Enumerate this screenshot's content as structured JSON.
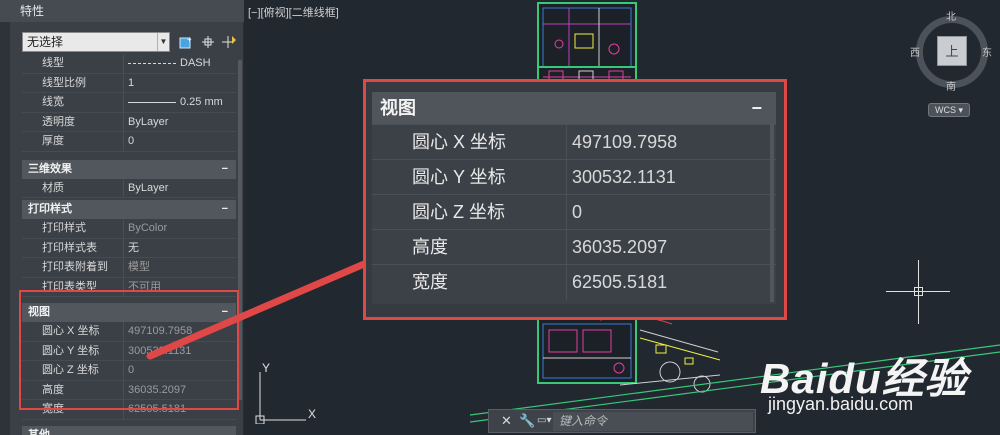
{
  "palette": {
    "title": "特性",
    "selection": "无选择",
    "general_rows": [
      {
        "label": "线型",
        "value": "DASH",
        "sample": "dash"
      },
      {
        "label": "线型比例",
        "value": "1"
      },
      {
        "label": "线宽",
        "value": "0.25 mm",
        "sample": "solid"
      },
      {
        "label": "透明度",
        "value": "ByLayer"
      },
      {
        "label": "厚度",
        "value": "0"
      }
    ],
    "sections": {
      "effects": {
        "title": "三维效果",
        "rows": [
          {
            "label": "材质",
            "value": "ByLayer"
          }
        ]
      },
      "plot": {
        "title": "打印样式",
        "rows": [
          {
            "label": "打印样式",
            "value": "ByColor"
          },
          {
            "label": "打印样式表",
            "value": "无"
          },
          {
            "label": "打印表附着到",
            "value": "模型"
          },
          {
            "label": "打印表类型",
            "value": "不可用"
          }
        ]
      },
      "view": {
        "title": "视图",
        "rows": [
          {
            "label": "圆心 X 坐标",
            "value": "497109.7958"
          },
          {
            "label": "圆心 Y 坐标",
            "value": "300532.1131"
          },
          {
            "label": "圆心 Z 坐标",
            "value": "0"
          },
          {
            "label": "高度",
            "value": "36035.2097"
          },
          {
            "label": "宽度",
            "value": "62505.5181"
          }
        ]
      },
      "misc": {
        "title": "其他"
      }
    },
    "collapse_symbol": "−"
  },
  "viewport": {
    "label": "[−][俯视][二维线框]"
  },
  "viewcube": {
    "north": "北",
    "south": "南",
    "east": "东",
    "west": "西",
    "face": "上",
    "wcs": "WCS"
  },
  "ucs": {
    "x": "X",
    "y": "Y"
  },
  "callout": {
    "title": "视图",
    "rows": [
      {
        "label": "圆心 X 坐标",
        "value": "497109.7958"
      },
      {
        "label": "圆心 Y 坐标",
        "value": "300532.1131"
      },
      {
        "label": "圆心 Z 坐标",
        "value": "0"
      },
      {
        "label": "高度",
        "value": "36035.2097"
      },
      {
        "label": "宽度",
        "value": "62505.5181"
      }
    ]
  },
  "command": {
    "placeholder": "键入命令"
  },
  "watermark": {
    "logo": "Baidu经验",
    "url": "jingyan.baidu.com"
  },
  "colors": {
    "accent_red": "#e04848",
    "sheet_green": "#38c878",
    "bg": "#212830"
  }
}
